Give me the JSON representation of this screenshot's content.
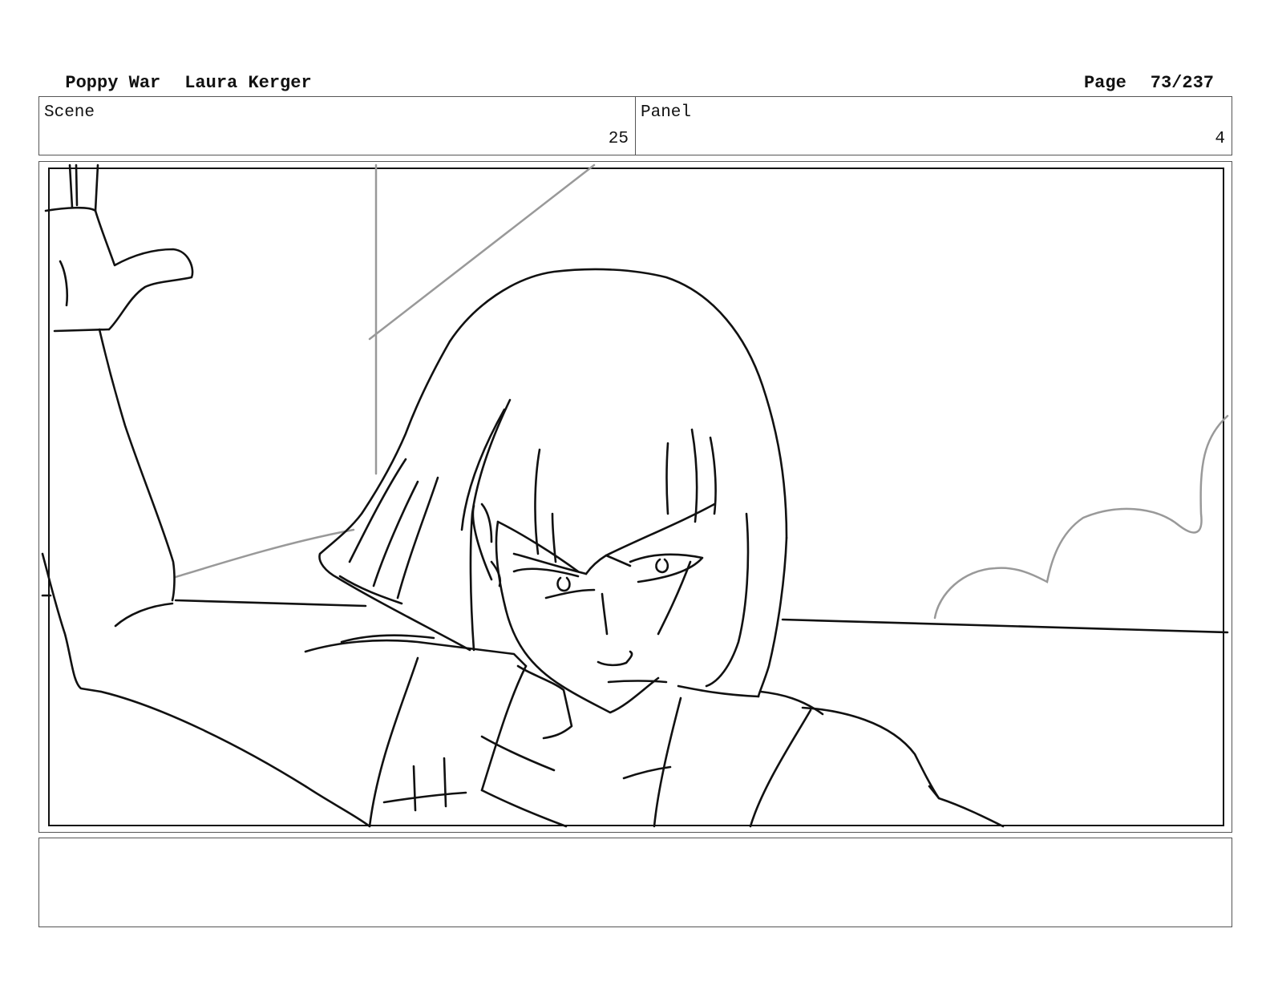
{
  "header": {
    "title": "Poppy War",
    "author": "Laura Kerger",
    "page_label": "Page",
    "page_number": "73/237"
  },
  "info": {
    "scene_label": "Scene",
    "scene_value": "25",
    "panel_label": "Panel",
    "panel_value": "4"
  },
  "frame": {
    "drawing": "sketch-character-raised-arm"
  },
  "notes": {
    "text": ""
  }
}
